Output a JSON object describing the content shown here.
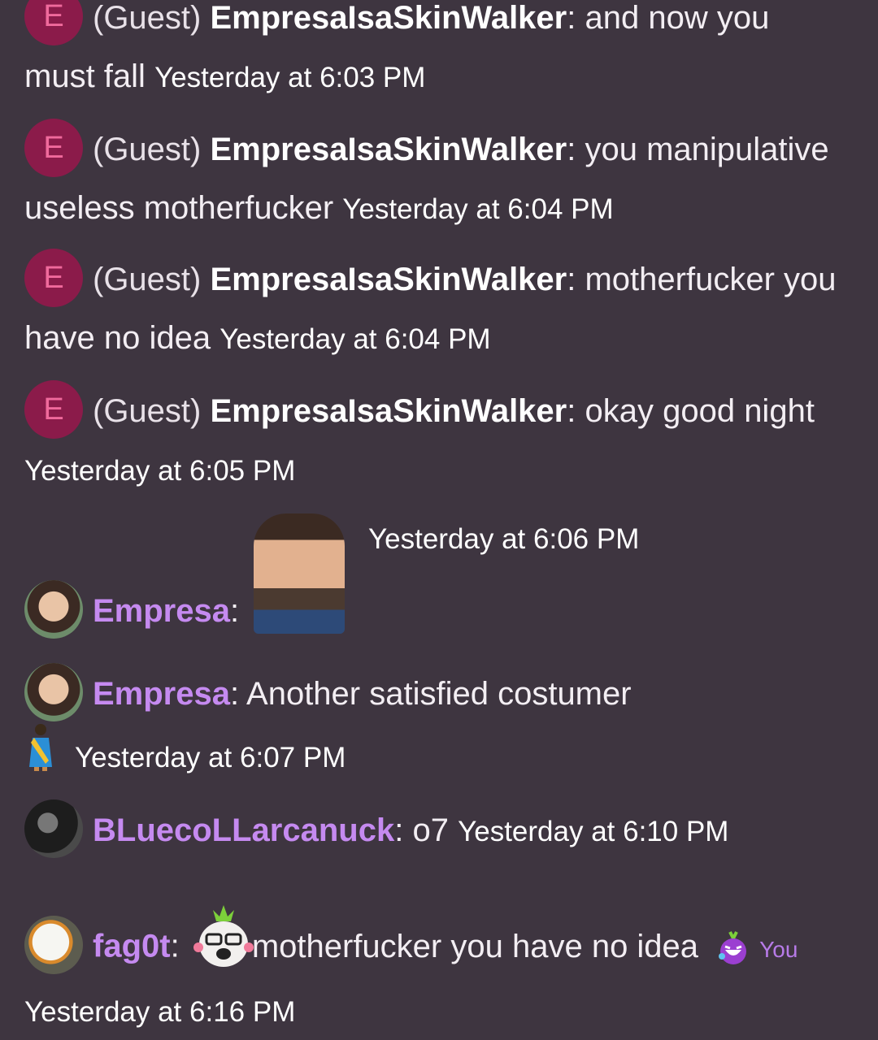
{
  "messages": [
    {
      "avatar_letter": "E",
      "guest_tag": "(Guest)",
      "username": "EmpresaIsaSkinWalker",
      "separator": ":",
      "text_line1": "and now you",
      "text_line2": "must fall",
      "timestamp": "Yesterday at 6:03 PM"
    },
    {
      "avatar_letter": "E",
      "guest_tag": "(Guest)",
      "username": "EmpresaIsaSkinWalker",
      "separator": ":",
      "text_line1": "you manipulative",
      "text_line2": "useless motherfucker",
      "timestamp": "Yesterday at 6:04 PM"
    },
    {
      "avatar_letter": "E",
      "guest_tag": "(Guest)",
      "username": "EmpresaIsaSkinWalker",
      "separator": ":",
      "text_line1": "motherfucker you",
      "text_line2": "have no idea",
      "timestamp": "Yesterday at 6:04 PM"
    },
    {
      "avatar_letter": "E",
      "guest_tag": "(Guest)",
      "username": "EmpresaIsaSkinWalker",
      "separator": ":",
      "text_line1": "okay good night",
      "timestamp": "Yesterday at 6:05 PM"
    },
    {
      "username": "Empresa",
      "separator": ":",
      "timestamp": "Yesterday at 6:06 PM"
    },
    {
      "username": "Empresa",
      "separator": ":",
      "text": "Another satisfied costumer",
      "timestamp": "Yesterday at 6:07 PM"
    },
    {
      "username": "BLuecoLLarcanuck",
      "separator": ":",
      "text": "o7",
      "timestamp": "Yesterday at 6:10 PM"
    },
    {
      "username": "fag0t",
      "separator": ":",
      "text": "motherfucker you have no idea",
      "you_label": "You",
      "timestamp": "Yesterday at 6:16 PM"
    }
  ],
  "colors": {
    "background": "#3e3540",
    "guest_avatar": "#8b1b4a",
    "member_name": "#c58af0"
  }
}
